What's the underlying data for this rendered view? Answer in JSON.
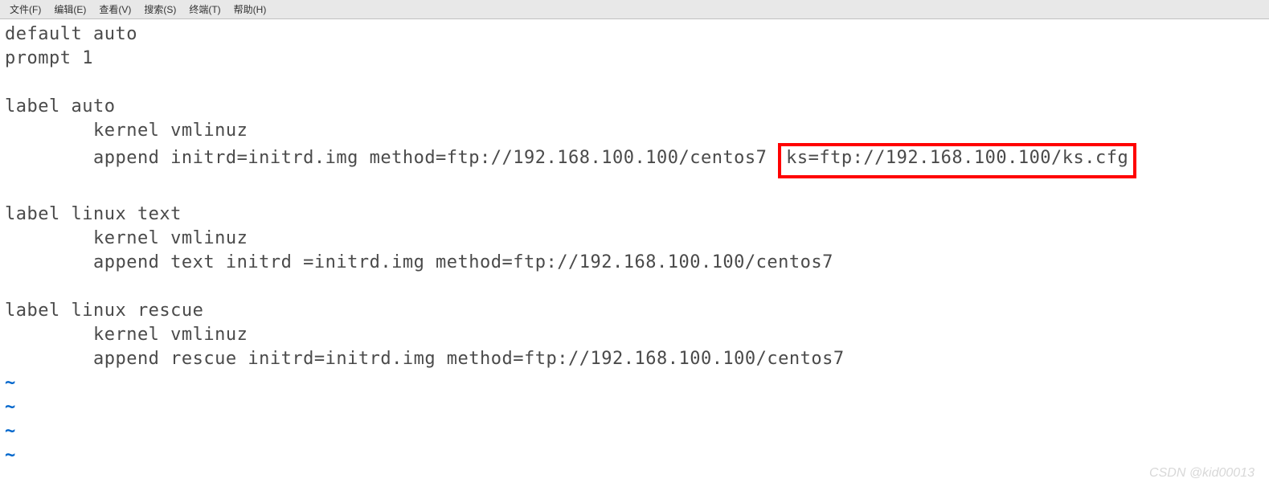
{
  "menubar": {
    "items": [
      {
        "label": "文件(F)"
      },
      {
        "label": "编辑(E)"
      },
      {
        "label": "查看(V)"
      },
      {
        "label": "搜索(S)"
      },
      {
        "label": "终端(T)"
      },
      {
        "label": "帮助(H)"
      }
    ]
  },
  "editor": {
    "lines": {
      "l1": "default auto",
      "l2": "prompt 1",
      "l3": "",
      "l4": "label auto",
      "l5": "        kernel vmlinuz",
      "l6a": "        append initrd=initrd.img method=ftp://192.168.100.100/centos7",
      "l6b": "ks=ftp://192.168.100.100/ks.cfg",
      "l7": "",
      "l8": "label linux text",
      "l9": "        kernel vmlinuz",
      "l10": "        append text initrd =initrd.img method=ftp://192.168.100.100/centos7",
      "l11": "",
      "l12": "label linux rescue",
      "l13": "        kernel vmlinuz",
      "l14": "        append rescue initrd=initrd.img method=ftp://192.168.100.100/centos7"
    },
    "tilde": "~"
  },
  "watermark": "CSDN @kid00013"
}
